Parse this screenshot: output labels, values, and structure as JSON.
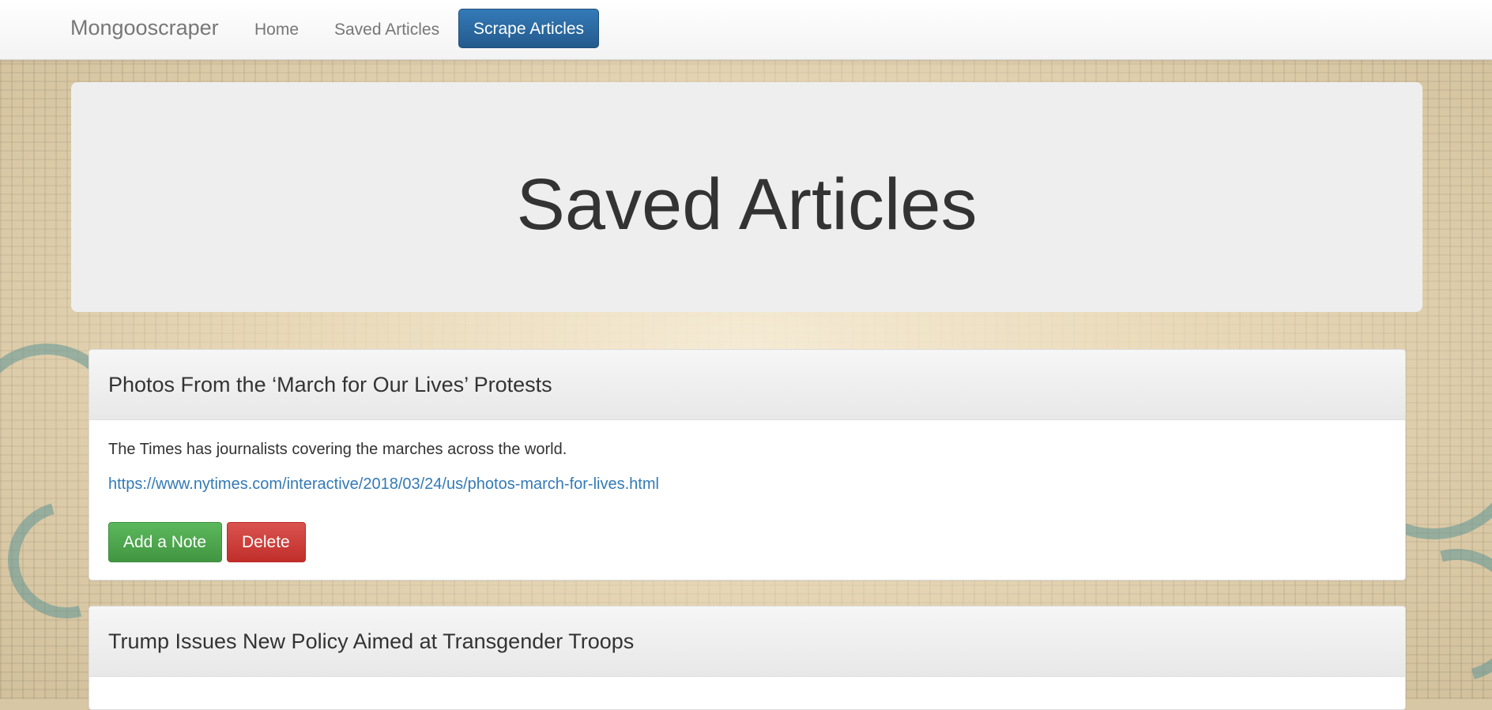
{
  "navbar": {
    "brand": "Mongooscraper",
    "links": [
      {
        "label": "Home"
      },
      {
        "label": "Saved Articles"
      }
    ],
    "scrape_button": "Scrape Articles"
  },
  "jumbotron": {
    "title": "Saved Articles"
  },
  "articles": [
    {
      "title": "Photos From the ‘March for Our Lives’ Protests",
      "summary": "The Times has journalists covering the marches across the world.",
      "url": "https://www.nytimes.com/interactive/2018/03/24/us/photos-march-for-lives.html",
      "add_note_label": "Add a Note",
      "delete_label": "Delete"
    },
    {
      "title": "Trump Issues New Policy Aimed at Transgender Troops"
    }
  ],
  "colors": {
    "primary": "#337ab7",
    "success": "#5cb85c",
    "danger": "#d9534f"
  }
}
